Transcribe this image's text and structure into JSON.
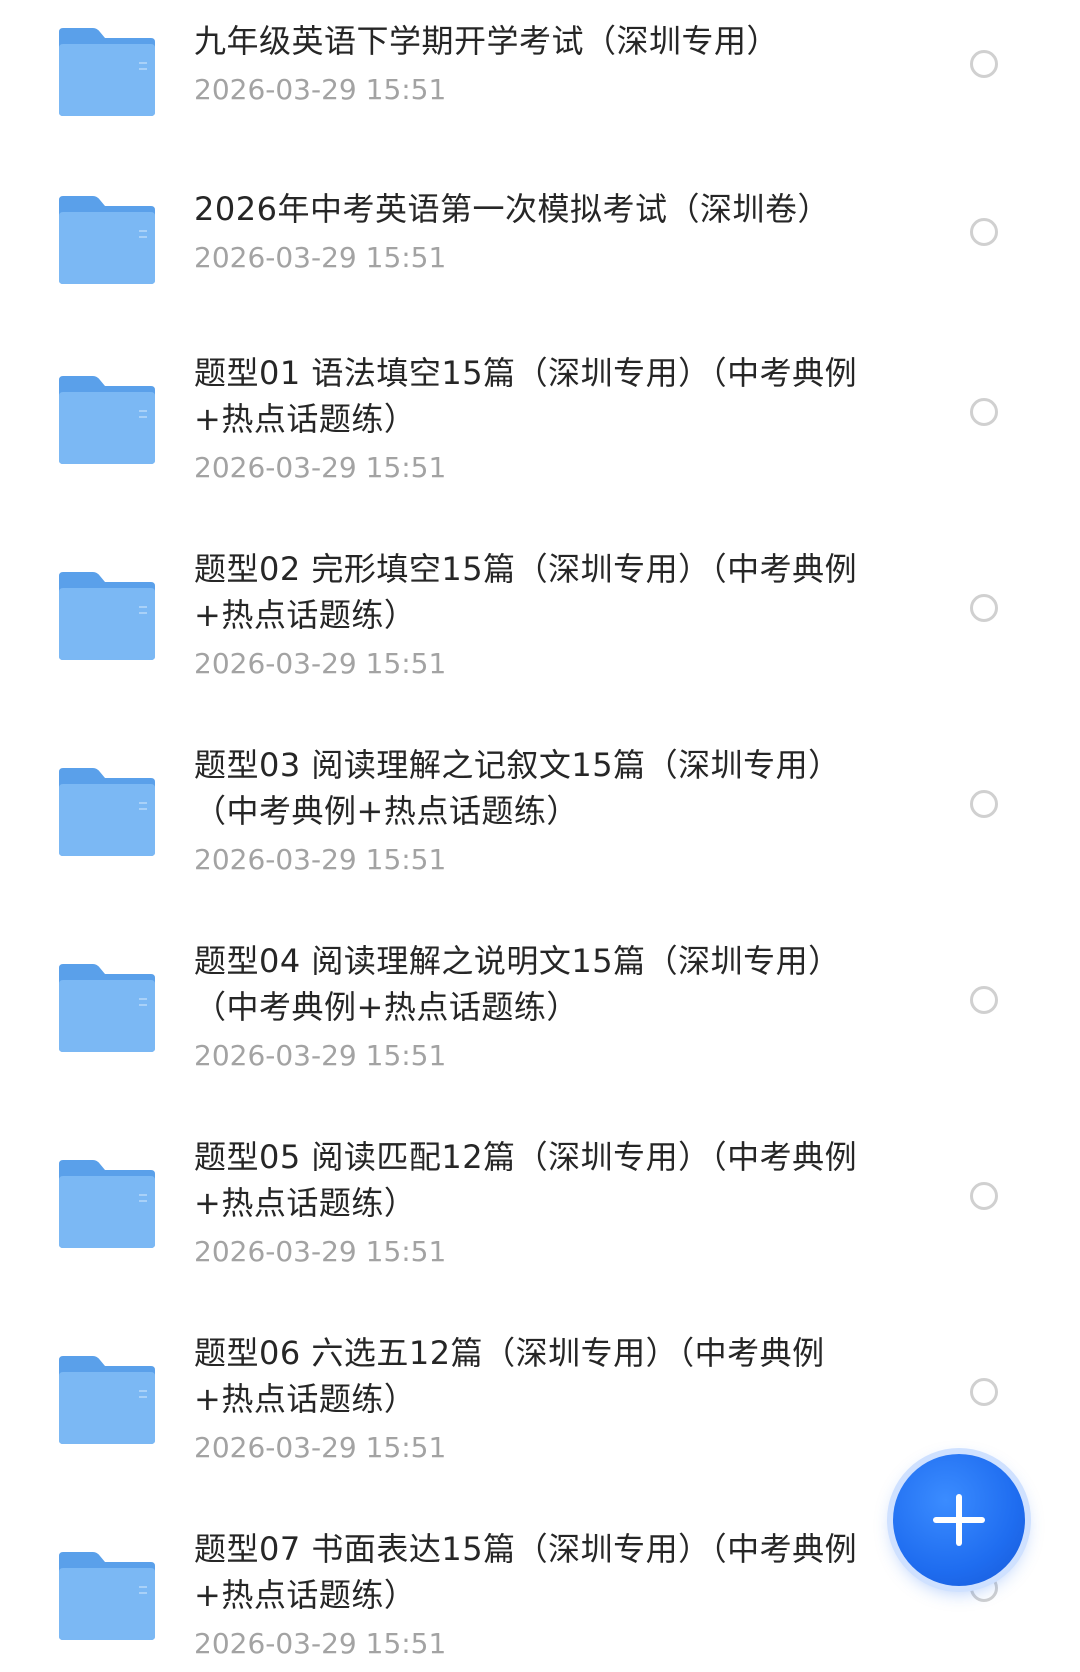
{
  "colors": {
    "folder": "#6fb1f2",
    "folder_dark": "#5aa0ea",
    "title_text": "#262626",
    "date_text": "#a3a3a3",
    "radio_border": "#d0d0d0",
    "fab": "#1f6df0"
  },
  "files": [
    {
      "name": "九年级英语下学期开学考试（深圳专用）",
      "date": "2026-03-29 15:51",
      "icon": "folder-icon"
    },
    {
      "name": "2026年中考英语第一次模拟考试（深圳卷）",
      "date": "2026-03-29 15:51",
      "icon": "folder-icon"
    },
    {
      "name": "题型01 语法填空15篇（深圳专用）（中考典例+热点话题练）",
      "date": "2026-03-29 15:51",
      "icon": "folder-icon"
    },
    {
      "name": "题型02 完形填空15篇（深圳专用）（中考典例+热点话题练）",
      "date": "2026-03-29 15:51",
      "icon": "folder-icon"
    },
    {
      "name": "题型03 阅读理解之记叙文15篇（深圳专用）（中考典例+热点话题练）",
      "date": "2026-03-29 15:51",
      "icon": "folder-icon"
    },
    {
      "name": "题型04 阅读理解之说明文15篇（深圳专用）（中考典例+热点话题练）",
      "date": "2026-03-29 15:51",
      "icon": "folder-icon"
    },
    {
      "name": "题型05 阅读匹配12篇（深圳专用）（中考典例+热点话题练）",
      "date": "2026-03-29 15:51",
      "icon": "folder-icon"
    },
    {
      "name": "题型06 六选五12篇（深圳专用）（中考典例+热点话题练）",
      "date": "2026-03-29 15:51",
      "icon": "folder-icon"
    },
    {
      "name": "题型07 书面表达15篇（深圳专用）（中考典例+热点话题练）",
      "date": "2026-03-29 15:51",
      "icon": "folder-icon"
    }
  ],
  "fab": {
    "icon": "plus-icon"
  }
}
